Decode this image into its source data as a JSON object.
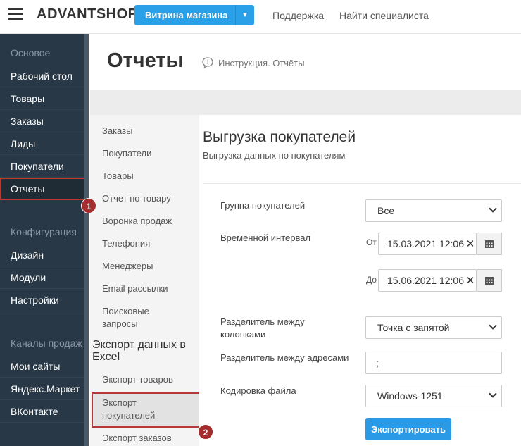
{
  "topbar": {
    "logo": "ADVANTSHOP",
    "store_button": "Витрина магазина",
    "links": [
      "Поддержка",
      "Найти специалиста"
    ]
  },
  "sidebar": {
    "sections": [
      {
        "title": "Основое",
        "items": [
          "Рабочий стол",
          "Товары",
          "Заказы",
          "Лиды",
          "Покупатели",
          "Отчеты"
        ]
      },
      {
        "title": "Конфигурация",
        "items": [
          "Дизайн",
          "Модули",
          "Настройки"
        ]
      },
      {
        "title": "Каналы продаж",
        "items": [
          "Мои сайты",
          "Яндекс.Маркет",
          "ВКонтакте"
        ]
      }
    ],
    "active_item": "Отчеты"
  },
  "header": {
    "title": "Отчеты",
    "instruction_link": "Инструкция. Отчёты"
  },
  "reports_nav": {
    "items": [
      "Заказы",
      "Покупатели",
      "Товары",
      "Отчет по товару",
      "Воронка продаж",
      "Телефония",
      "Менеджеры",
      "Email рассылки",
      "Поисковые запросы"
    ],
    "export_heading": "Экспорт данных в Excel",
    "export_items": [
      "Экспорт товаров",
      "Экспорт покупателей",
      "Экспорт заказов"
    ],
    "active_item": "Экспорт покупателей"
  },
  "main": {
    "title": "Выгрузка покупателей",
    "subtitle": "Выгрузка данных по покупателям",
    "group_label": "Группа покупателей",
    "group_value": "Все",
    "interval_label": "Временной интервал",
    "from_label": "От",
    "from_value": "15.03.2021 12:06",
    "to_label": "До",
    "to_value": "15.06.2021 12:06",
    "column_sep_label": "Разделитель между колонками",
    "column_sep_value": "Точка с запятой",
    "address_sep_label": "Разделитель между адресами",
    "address_sep_value": ";",
    "encoding_label": "Кодировка файла",
    "encoding_value": "Windows-1251",
    "export_button": "Экспортировать"
  },
  "annotations": [
    "1",
    "2"
  ],
  "colors": {
    "sidebar_bg": "#283846",
    "accent": "#2a9ae6",
    "highlight": "#b33a3a"
  }
}
